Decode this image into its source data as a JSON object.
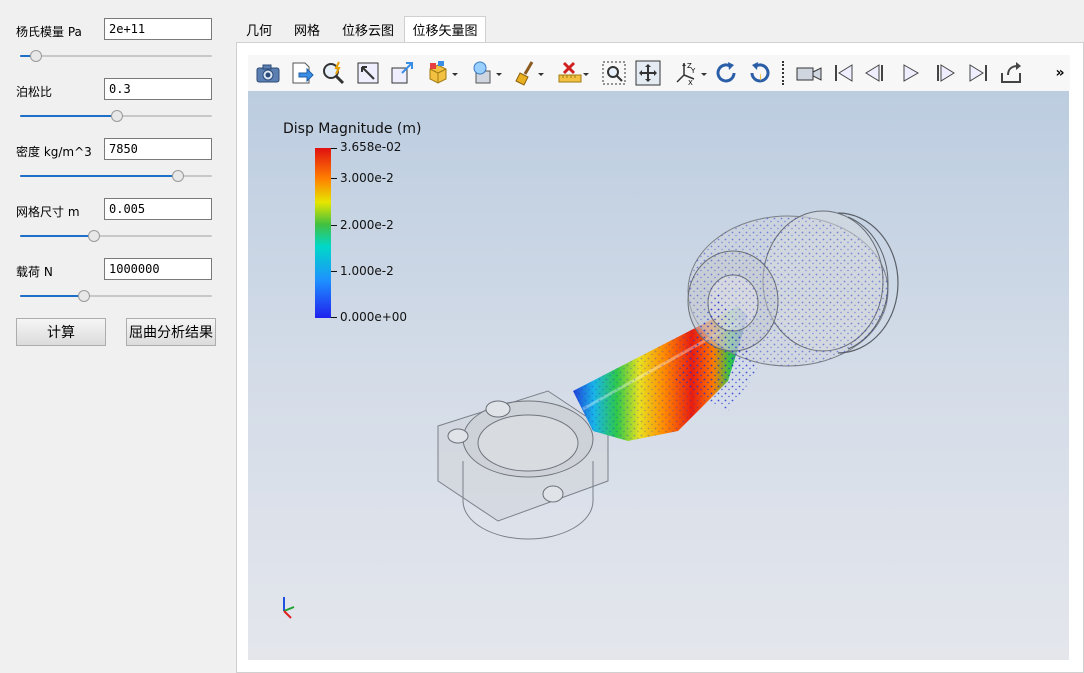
{
  "params": [
    {
      "label": "杨氏模量 Pa",
      "value": "2e+11",
      "slider": 0.08
    },
    {
      "label": "泊松比",
      "value": "0.3",
      "slider": 0.5
    },
    {
      "label": "密度 kg/m^3",
      "value": "7850",
      "slider": 0.82
    },
    {
      "label": "网格尺寸 m",
      "value": "0.005",
      "slider": 0.38
    },
    {
      "label": "载荷 N",
      "value": "1000000",
      "slider": 0.33
    }
  ],
  "buttons": {
    "compute": "计算",
    "buckling": "屈曲分析结果"
  },
  "tabs": [
    {
      "label": "几何",
      "active": false
    },
    {
      "label": "网格",
      "active": false
    },
    {
      "label": "位移云图",
      "active": false
    },
    {
      "label": "位移矢量图",
      "active": true
    }
  ],
  "toolbar": {
    "more": "»"
  },
  "legend": {
    "title": "Disp Magnitude (m)",
    "ticks": [
      "3.658e-02",
      "3.000e-2",
      "2.000e-2",
      "1.000e-2",
      "0.000e+00"
    ]
  },
  "axes": {
    "x": "X",
    "y": "Y",
    "z": "Z"
  }
}
